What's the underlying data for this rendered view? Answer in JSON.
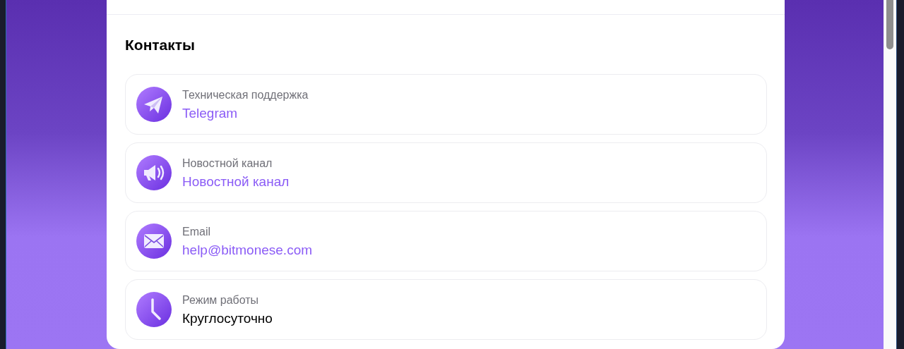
{
  "contacts": {
    "title": "Контакты",
    "items": [
      {
        "label": "Техническая поддержка",
        "value": "Telegram",
        "kind": "link"
      },
      {
        "label": "Новостной канал",
        "value": "Новостной канал",
        "kind": "link"
      },
      {
        "label": "Email",
        "value": "help@bitmonese.com",
        "kind": "link"
      },
      {
        "label": "Режим работы",
        "value": "Круглосуточно",
        "kind": "text"
      }
    ]
  }
}
